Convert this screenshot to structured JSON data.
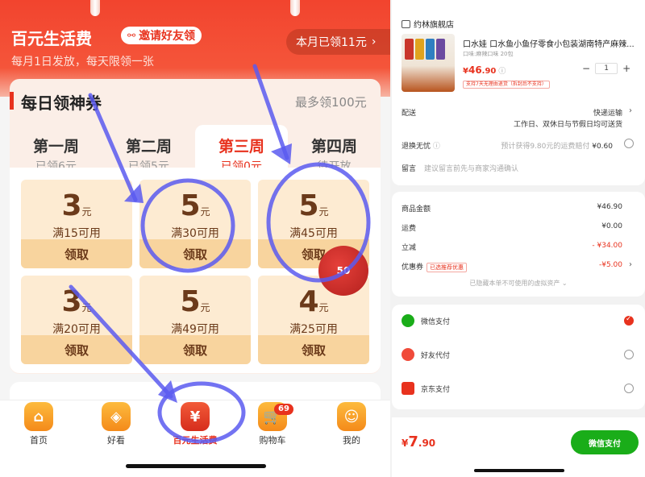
{
  "left": {
    "header": {
      "title": "百元生活费",
      "invite_label": "邀请好友领",
      "subtitle": "每月1日发放，每天限领一张",
      "monthly_claimed": "本月已领11元"
    },
    "daily": {
      "title": "每日领神券",
      "max_label": "最多领100元",
      "weeks": [
        {
          "name": "第一周",
          "status": "已领6元"
        },
        {
          "name": "第二周",
          "status": "已领5元"
        },
        {
          "name": "第三周",
          "status": "已领0元"
        },
        {
          "name": "第四周",
          "status": "待开放"
        }
      ],
      "unit": "元",
      "claim_label": "领取",
      "coupons": [
        {
          "amount": "3",
          "condition": "满15可用"
        },
        {
          "amount": "5",
          "condition": "满30可用"
        },
        {
          "amount": "5",
          "condition": "满45可用"
        },
        {
          "amount": "3",
          "condition": "满20可用"
        },
        {
          "amount": "5",
          "condition": "满49可用"
        },
        {
          "amount": "4",
          "condition": "满25可用"
        }
      ],
      "floating_badge": "50"
    },
    "tabs": [
      {
        "label": "首页"
      },
      {
        "label": "好看"
      },
      {
        "label": "百元生活费"
      },
      {
        "label": "购物车",
        "badge": "69"
      },
      {
        "label": "我的"
      }
    ]
  },
  "right": {
    "store_name": "约林旗舰店",
    "product": {
      "name": "口水娃 口水鱼小鱼仔零食小包装湖南特产麻辣...",
      "spec": "口味:麻辣口味 20包",
      "price_symbol": "¥",
      "price_int": "46",
      "price_dec": ".90",
      "quantity": "1",
      "tag": "支持7天无理由退货（拆封后不支持）"
    },
    "delivery": {
      "label": "配送",
      "value": "快递运输",
      "detail": "工作日、双休日与节假日均可送货"
    },
    "return": {
      "label": "退换无忧",
      "value": "预计获得9.80元的运费赔付",
      "price": "¥0.60"
    },
    "message": {
      "label": "留言",
      "placeholder": "建议留言前先与商家沟通确认"
    },
    "summary": {
      "goods_label": "商品金额",
      "goods_value": "¥46.90",
      "shipping_label": "运费",
      "shipping_value": "¥0.00",
      "discount_label": "立减",
      "discount_value": "- ¥34.00",
      "coupon_label": "优惠券",
      "coupon_tag": "已选推荐优惠",
      "coupon_value": "-¥5.00",
      "hidden_note": "已隐藏本单不可使用的虚拟资产"
    },
    "payments": [
      {
        "label": "微信支付",
        "selected": true
      },
      {
        "label": "好友代付",
        "selected": false
      },
      {
        "label": "京东支付",
        "selected": false
      }
    ],
    "total_symbol": "¥",
    "total_int": "7",
    "total_dec": ".90",
    "pay_button": "微信支付"
  },
  "colors": {
    "brand_red": "#e8321e",
    "coupon_bg": "#fdebd2",
    "claim_bg": "#f8d49e",
    "wechat_green": "#1aad19",
    "annotation_blue": "#5b5bf0"
  }
}
